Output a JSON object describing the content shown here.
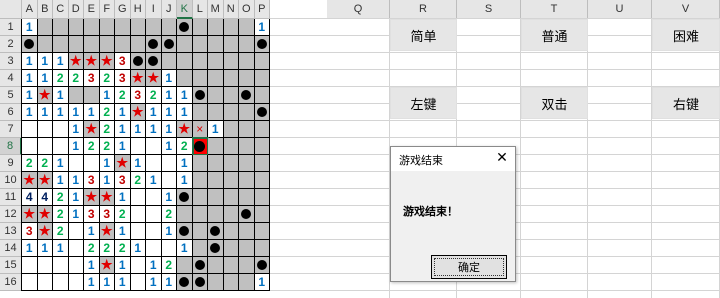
{
  "columns": [
    "A",
    "B",
    "C",
    "D",
    "E",
    "F",
    "G",
    "H",
    "I",
    "J",
    "K",
    "L",
    "M",
    "N",
    "O",
    "P",
    "Q",
    "R",
    "S",
    "T",
    "U",
    "V"
  ],
  "selected_column": "K",
  "selected_row": "8",
  "rows": [
    "1",
    "2",
    "3",
    "4",
    "5",
    "6",
    "7",
    "8",
    "9",
    "10",
    "11",
    "12",
    "13",
    "14",
    "15",
    "16"
  ],
  "grid_legend": {
    "C": "covered cell",
    "M": "mine",
    "F": "flag",
    "X": "wrong flag",
    "B": "exploded mine",
    "_": "revealed empty",
    "digit": "revealed number"
  },
  "board": [
    "1CCCCCCCCCMCCCC1",
    "MCCCCCCCMMCCCCCM",
    "111FFF3MMCCCCCCC",
    "1122323FF1CCCCCC",
    "1F1CC123211MCCMC",
    "1111121F111CCCCM",
    "___1F21111FX1CCC",
    "___1221__12BCCCC",
    "221__1F1__1CCCCC",
    "FF1131321_1CCCCC",
    "4421FF1__1MCCCCC",
    "FF21332__2CCCCMC",
    "3F2_1F1__1MCMCCC",
    "111_2221__1CMCCC",
    "____1F1_12CMCCCM",
    "____111_11MMCCC1"
  ],
  "number_colors": {
    "1": "#0070c0",
    "2": "#00b050",
    "3": "#c00000",
    "4": "#002060"
  },
  "buttons": {
    "easy": "简单",
    "normal": "普通",
    "hard": "困难",
    "left_click": "左键",
    "double_click": "双击",
    "right_click": "右键"
  },
  "symbols": {
    "flag": "★",
    "wrong": "×"
  },
  "dialog": {
    "title": "游戏结束",
    "message": "游戏结束！",
    "ok_label": "确定",
    "close_glyph": "✕"
  }
}
